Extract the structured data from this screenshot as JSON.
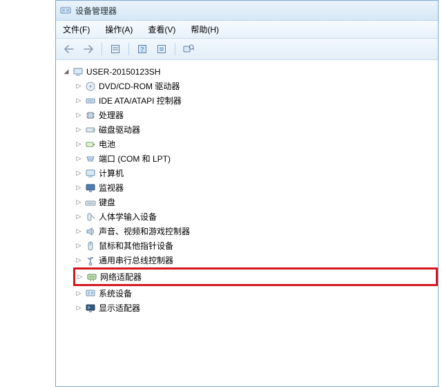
{
  "window": {
    "title": "设备管理器"
  },
  "menubar": {
    "file": "文件(F)",
    "action": "操作(A)",
    "view": "查看(V)",
    "help": "帮助(H)"
  },
  "toolbar": {
    "back": "back",
    "forward": "forward",
    "properties": "properties",
    "help": "help",
    "show_hidden": "show-hidden",
    "scan": "scan"
  },
  "tree": {
    "root": {
      "label": "USER-20150123SH",
      "expanded": true
    },
    "children": [
      {
        "id": "dvd",
        "label": "DVD/CD-ROM 驱动器",
        "icon": "disc"
      },
      {
        "id": "ide",
        "label": "IDE ATA/ATAPI 控制器",
        "icon": "ide"
      },
      {
        "id": "cpu",
        "label": "处理器",
        "icon": "cpu"
      },
      {
        "id": "disk",
        "label": "磁盘驱动器",
        "icon": "disk"
      },
      {
        "id": "battery",
        "label": "电池",
        "icon": "battery"
      },
      {
        "id": "ports",
        "label": "端口 (COM 和 LPT)",
        "icon": "port"
      },
      {
        "id": "computer",
        "label": "计算机",
        "icon": "computer"
      },
      {
        "id": "monitor",
        "label": "监视器",
        "icon": "monitor"
      },
      {
        "id": "keyboard",
        "label": "键盘",
        "icon": "keyboard"
      },
      {
        "id": "hid",
        "label": "人体学输入设备",
        "icon": "hid"
      },
      {
        "id": "sound",
        "label": "声音、视频和游戏控制器",
        "icon": "sound"
      },
      {
        "id": "mouse",
        "label": "鼠标和其他指针设备",
        "icon": "mouse"
      },
      {
        "id": "usb",
        "label": "通用串行总线控制器",
        "icon": "usb"
      },
      {
        "id": "network",
        "label": "网络适配器",
        "icon": "network",
        "highlight": true
      },
      {
        "id": "sysdev",
        "label": "系统设备",
        "icon": "system"
      },
      {
        "id": "display",
        "label": "显示适配器",
        "icon": "display"
      }
    ]
  },
  "annotation": {
    "highlighted_item": "网络适配器"
  }
}
